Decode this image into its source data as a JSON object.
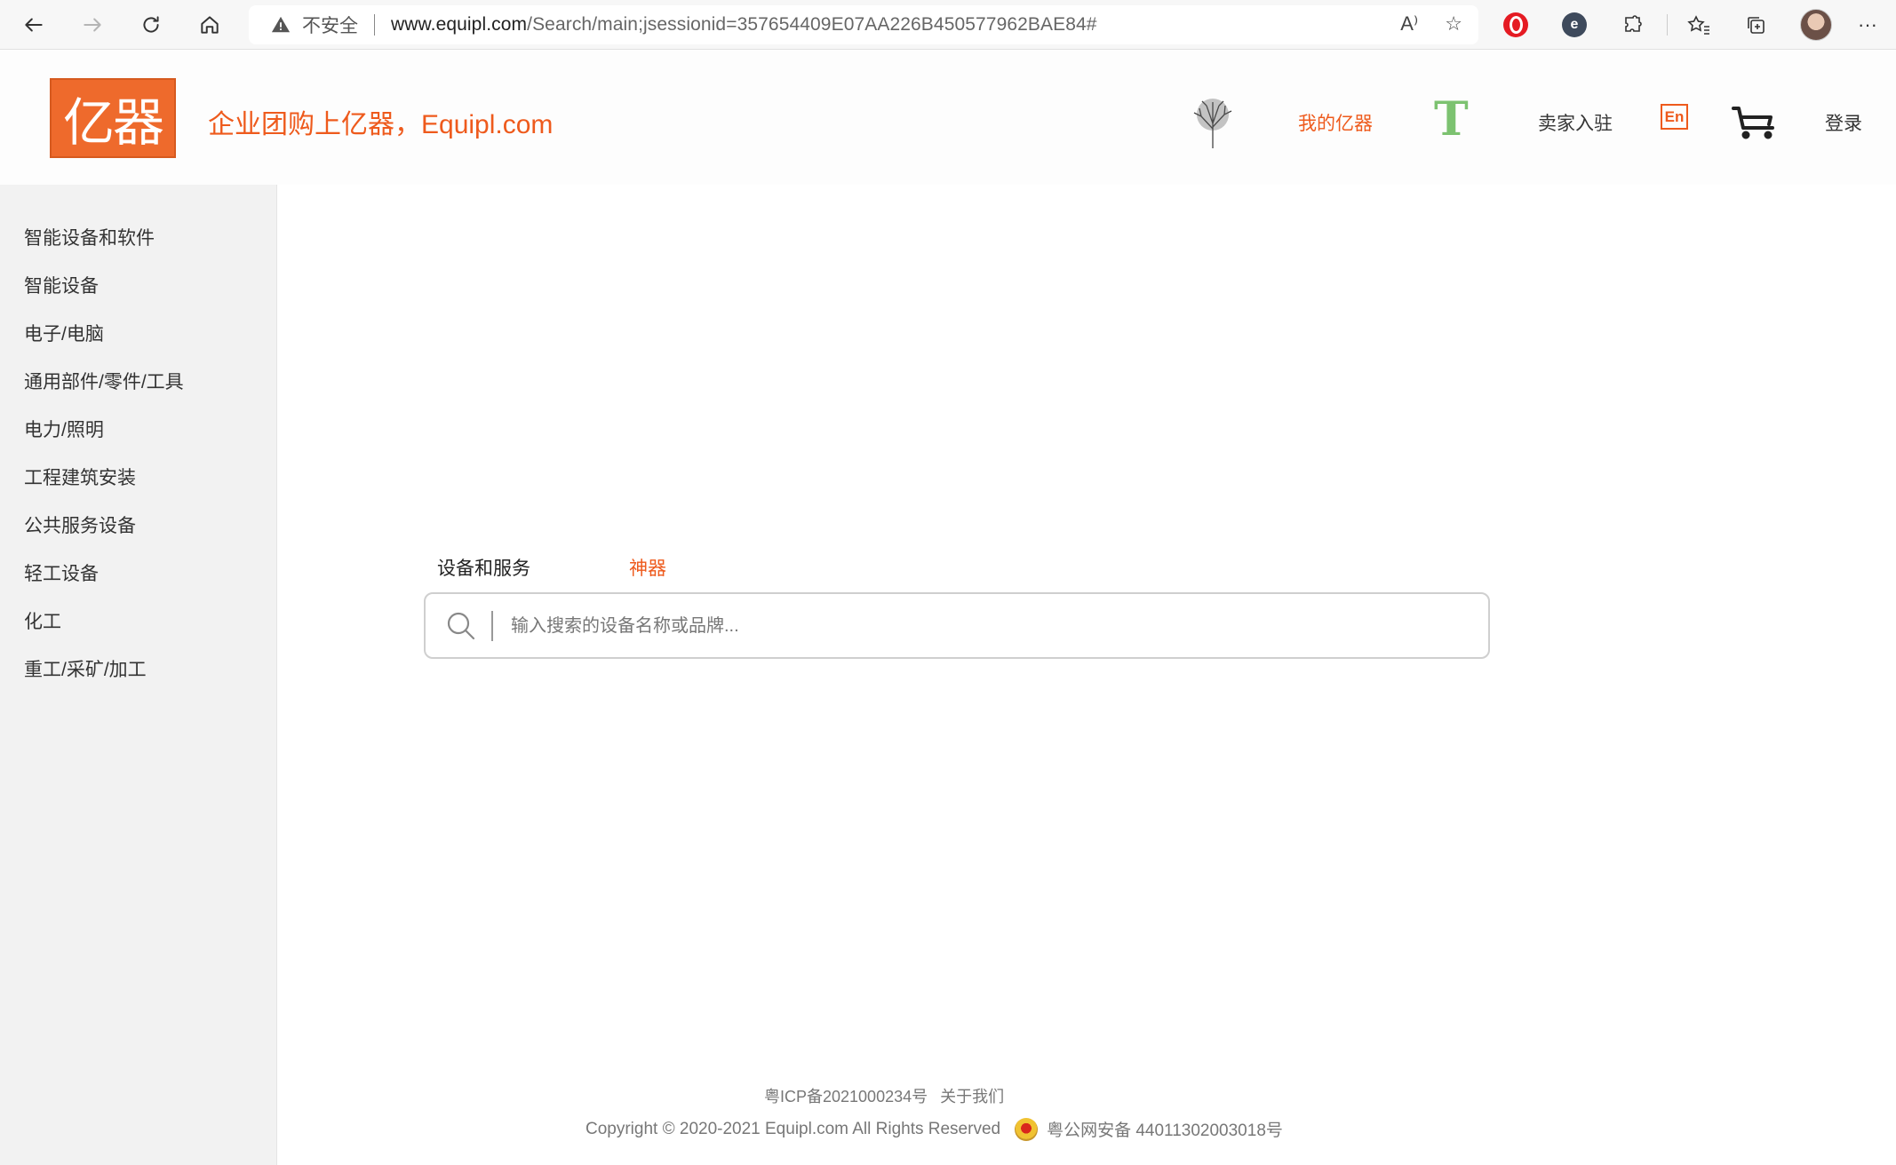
{
  "browser": {
    "insecure_label": "不安全",
    "url_host": "www.equipl.com",
    "url_path": "/Search/main;jsessionid=357654409E07AA226B450577962BAE84#",
    "read_aloud_icon": "A⁾",
    "favorite_icon": "☆"
  },
  "header": {
    "logo_text": "亿器",
    "slogan": "企业团购上亿器，Equipl.com",
    "my_equipl": "我的亿器",
    "t_letter": "T",
    "seller": "卖家入驻",
    "lang": "En",
    "login": "登录"
  },
  "sidebar": {
    "items": [
      {
        "label": "智能设备和软件"
      },
      {
        "label": "智能设备"
      },
      {
        "label": "电子/电脑"
      },
      {
        "label": "通用部件/零件/工具"
      },
      {
        "label": "电力/照明"
      },
      {
        "label": "工程建筑安装"
      },
      {
        "label": "公共服务设备"
      },
      {
        "label": "轻工设备"
      },
      {
        "label": "化工"
      },
      {
        "label": "重工/采矿/加工"
      }
    ]
  },
  "search": {
    "tabs": [
      {
        "label": "设备和服务"
      },
      {
        "label": "神器"
      }
    ],
    "placeholder": "输入搜索的设备名称或品牌..."
  },
  "footer": {
    "icp": "粤ICP备2021000234号",
    "about": "关于我们",
    "copyright": "Copyright © 2020-2021 Equipl.com All Rights Reserved",
    "police": "粤公网安备 44011302003018号"
  },
  "colors": {
    "accent": "#ee5a1c",
    "logo_bg": "#ee6a2c",
    "t_green": "#7cc270",
    "sidebar_bg": "#f2f2f2"
  }
}
